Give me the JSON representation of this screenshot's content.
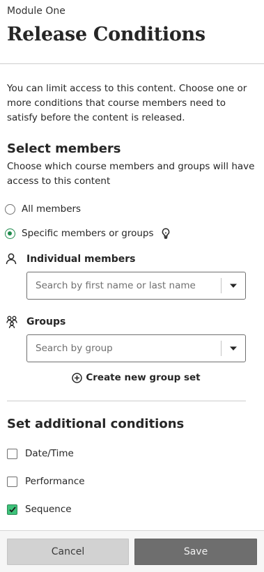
{
  "header": {
    "module_name": "Module One",
    "title": "Release Conditions"
  },
  "intro": "You can limit access to this content. Choose one or more conditions that course members need to satisfy before the content is released.",
  "select_members": {
    "title": "Select members",
    "description": "Choose which course members and groups will have access to this content",
    "options": [
      {
        "label": "All members",
        "checked": false
      },
      {
        "label": "Specific members or groups",
        "checked": true
      }
    ],
    "individual": {
      "label": "Individual members",
      "icon": "person-icon",
      "placeholder": "Search by first name or last name"
    },
    "groups": {
      "label": "Groups",
      "icon": "group-icon",
      "placeholder": "Search by group"
    },
    "create_group_label": "Create new group set"
  },
  "additional": {
    "title": "Set additional conditions",
    "conditions": [
      {
        "label": "Date/Time",
        "checked": false
      },
      {
        "label": "Performance",
        "checked": false
      },
      {
        "label": "Sequence",
        "checked": true
      }
    ]
  },
  "footer": {
    "cancel_label": "Cancel",
    "save_label": "Save"
  },
  "colors": {
    "accent_green": "#1f8a4c",
    "checkbox_green": "#3ec27a",
    "save_bg": "#6e6e6e",
    "cancel_bg": "#d2d2d2"
  }
}
